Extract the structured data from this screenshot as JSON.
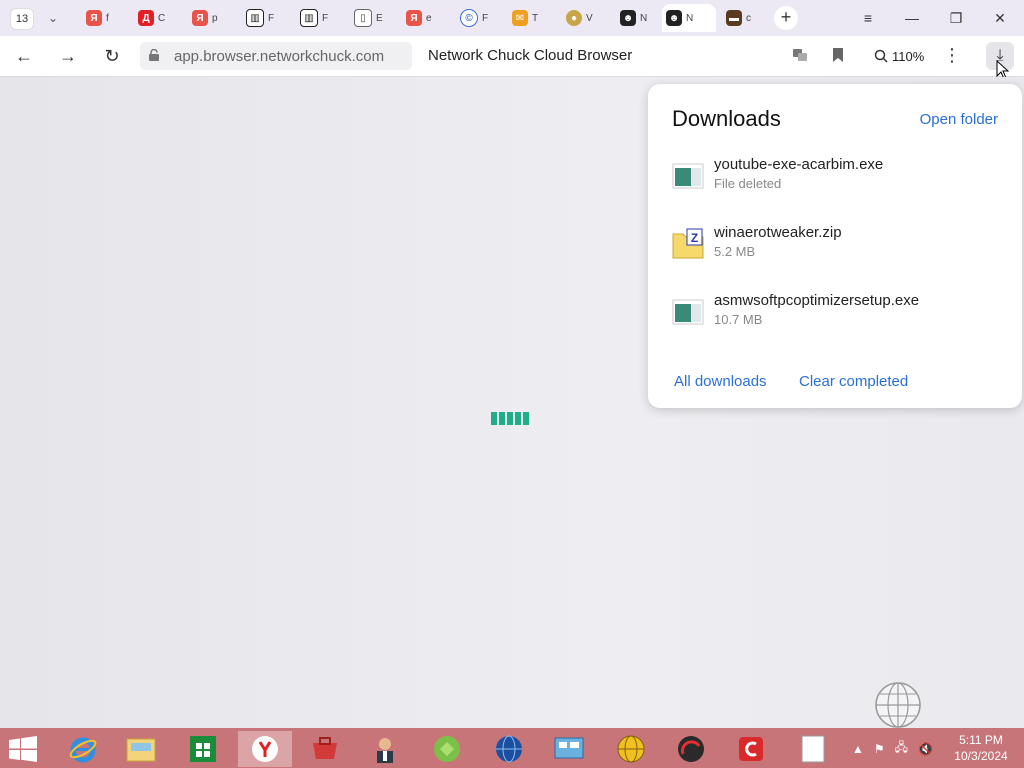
{
  "browser": {
    "tab_count": "13",
    "tabs": [
      {
        "label": "f",
        "color": "#e8534a",
        "glyph": "Я"
      },
      {
        "label": "C",
        "color": "#e31e24",
        "glyph": "Д"
      },
      {
        "label": "р",
        "color": "#e8534a",
        "glyph": "Я"
      },
      {
        "label": "F",
        "color": "#222222",
        "glyph": "▥"
      },
      {
        "label": "F",
        "color": "#222222",
        "glyph": "▥"
      },
      {
        "label": "E",
        "color": "#666666",
        "glyph": "▯"
      },
      {
        "label": "e",
        "color": "#e8534a",
        "glyph": "Я"
      },
      {
        "label": "F",
        "color": "#3b6fd6",
        "glyph": "©"
      },
      {
        "label": "T",
        "color": "#f0a020",
        "glyph": "✉"
      },
      {
        "label": "V",
        "color": "#c7a64a",
        "glyph": "●"
      },
      {
        "label": "N",
        "color": "#222222",
        "glyph": "☻"
      },
      {
        "label": "N",
        "color": "#222222",
        "glyph": "☻"
      },
      {
        "label": "c",
        "color": "#5a3a20",
        "glyph": "▬"
      }
    ],
    "new_tab": "+",
    "menu_icon": "≡",
    "minimize": "—",
    "restore": "❐",
    "close": "✕"
  },
  "toolbar": {
    "back": "←",
    "forward": "→",
    "reload": "↻",
    "url": "app.browser.networkchuck.com",
    "page_title": "Network Chuck Cloud Browser",
    "zoom": "110%",
    "more": "⋮",
    "download": "⤓"
  },
  "downloads": {
    "title": "Downloads",
    "open_folder": "Open folder",
    "items": [
      {
        "name": "youtube-exe-acarbim.exe",
        "status": "File deleted",
        "icon": "exe-icon"
      },
      {
        "name": "winaerotweaker.zip",
        "status": "5.2 MB",
        "icon": "zip-icon"
      },
      {
        "name": "asmwsoftpcoptimizersetup.exe",
        "status": "10.7 MB",
        "icon": "exe-icon"
      }
    ],
    "all_downloads": "All downloads",
    "clear_completed": "Clear completed"
  },
  "taskbar": {
    "clock_time": "5:11 PM",
    "clock_date": "10/3/2024",
    "accent": "#c8757a"
  },
  "colors": {
    "loader": "#1fae8a",
    "link": "#2a6fd6"
  }
}
